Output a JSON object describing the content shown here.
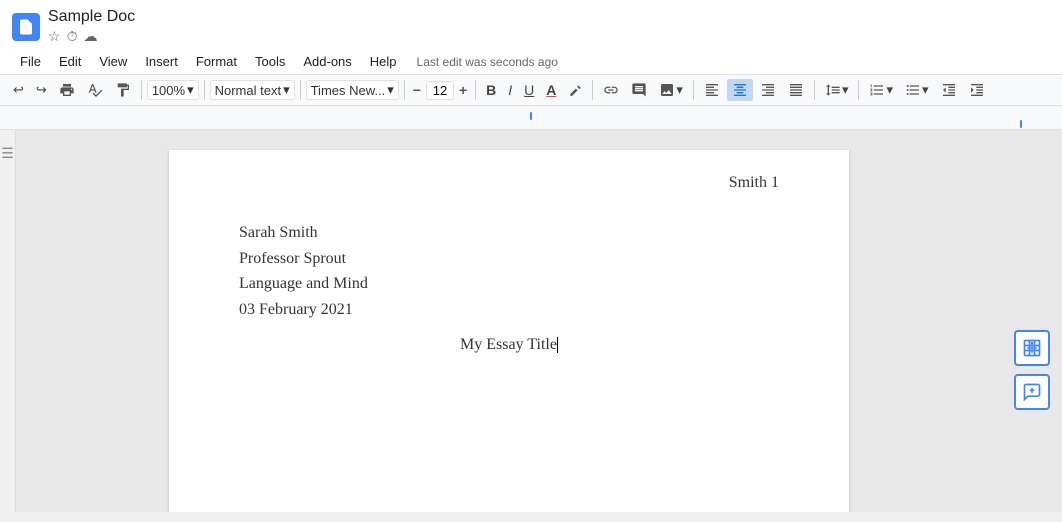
{
  "titleBar": {
    "docTitle": "Sample Doc",
    "starIcon": "★",
    "historyIcon": "⏱",
    "cloudIcon": "☁"
  },
  "menuBar": {
    "items": [
      "File",
      "Edit",
      "View",
      "Insert",
      "Format",
      "Tools",
      "Add-ons",
      "Help"
    ],
    "lastEdit": "Last edit was seconds ago"
  },
  "toolbar": {
    "undo": "↩",
    "redo": "↪",
    "print": "🖨",
    "spellcheck": "✓",
    "paintFormat": "🖌",
    "zoom": "100%",
    "zoomArrow": "▾",
    "style": "Normal text",
    "styleArrow": "▾",
    "font": "Times New...",
    "fontArrow": "▾",
    "fontSizeMinus": "−",
    "fontSize": "12",
    "fontSizePlus": "+",
    "bold": "B",
    "italic": "I",
    "underline": "U",
    "fontColor": "A",
    "highlight": "🖊",
    "link": "🔗",
    "comment": "💬",
    "image": "🖼",
    "imageArrow": "▾",
    "alignLeft": "≡",
    "alignCenter": "≡",
    "alignRight": "≡",
    "alignJustify": "≡",
    "lineSpacing": "↕",
    "lineSpacingArrow": "▾",
    "numberedList": "1≡",
    "numberedArrow": "▾",
    "bulletList": "•≡",
    "bulletArrow": "▾",
    "decreaseIndent": "⇤",
    "increaseIndent": "⇥"
  },
  "document": {
    "headerRight": "Smith 1",
    "lines": [
      "Sarah Smith",
      "Professor Sprout",
      "Language and Mind",
      "03 February 2021"
    ],
    "title": "My Essay Title"
  },
  "sidebarButtons": {
    "addTable": "+",
    "addComment": "💬"
  }
}
